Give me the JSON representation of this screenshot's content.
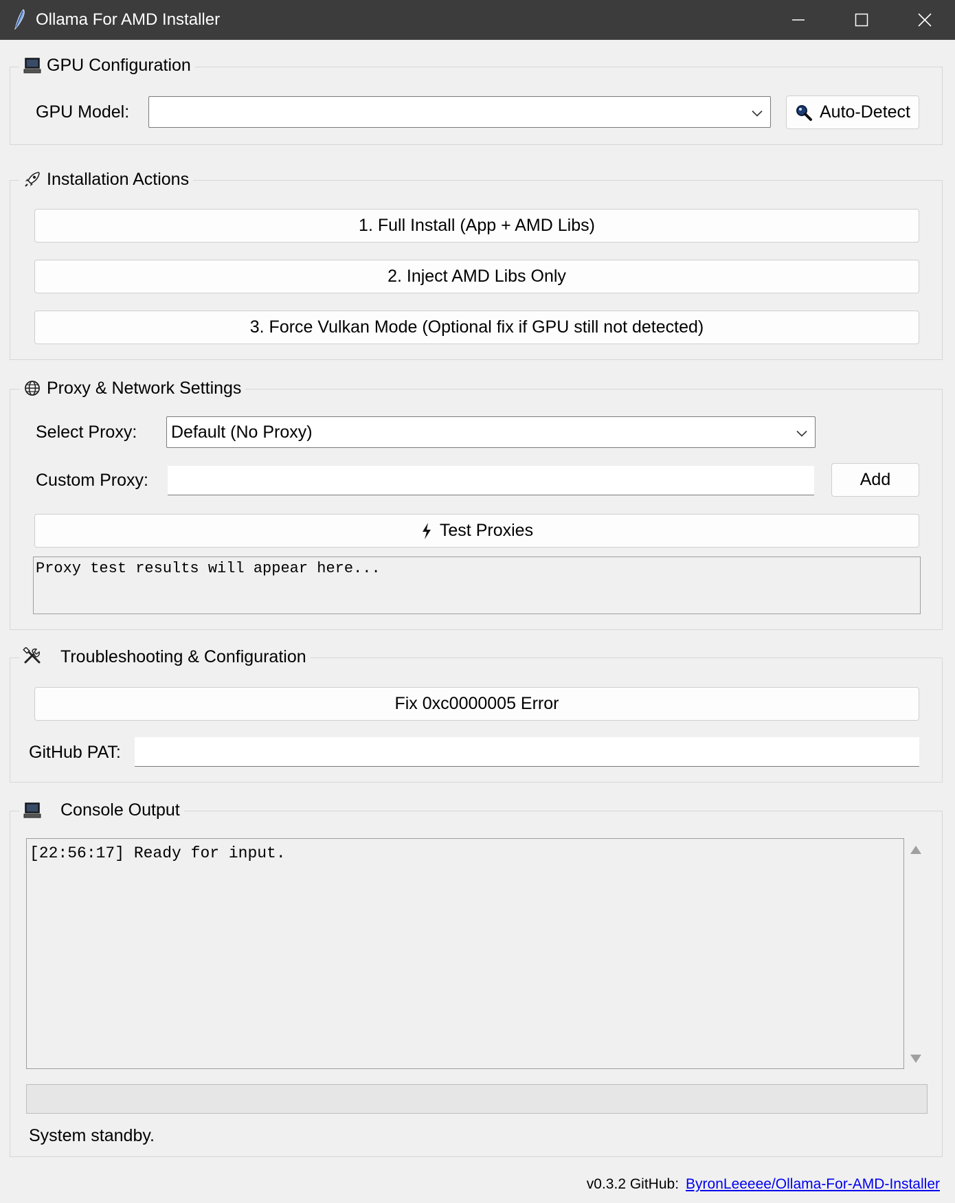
{
  "window": {
    "title": "Ollama For AMD Installer",
    "controls": {
      "minimize": "minimize-icon",
      "maximize": "maximize-icon",
      "close": "close-icon"
    },
    "title_bar_color": "#3c3c3c"
  },
  "gpu_config": {
    "legend": "GPU Configuration",
    "legend_icon": "computer-icon",
    "model_label": "GPU Model:",
    "model_value": "",
    "auto_detect_label": "Auto-Detect",
    "auto_detect_icon": "magnifier-icon"
  },
  "install_actions": {
    "legend": "Installation Actions",
    "legend_icon": "rocket-icon",
    "buttons": [
      {
        "label": "1. Full Install (App + AMD Libs)"
      },
      {
        "label": "2. Inject AMD Libs Only"
      },
      {
        "label": "3. Force Vulkan Mode (Optional fix if GPU still not detected)"
      }
    ]
  },
  "proxy": {
    "legend": "Proxy & Network Settings",
    "legend_icon": "globe-icon",
    "select_label": "Select Proxy:",
    "select_value": "Default (No Proxy)",
    "custom_label": "Custom Proxy:",
    "custom_value": "",
    "add_label": "Add",
    "test_label": "Test Proxies",
    "test_icon": "lightning-icon",
    "results_text": "Proxy test results will appear here..."
  },
  "troubleshooting": {
    "legend": "Troubleshooting & Configuration",
    "legend_icon": "tools-icon",
    "fix_label": "Fix 0xc0000005 Error",
    "pat_label": "GitHub PAT:",
    "pat_value": ""
  },
  "console": {
    "legend": "Console Output",
    "legend_icon": "computer-icon",
    "lines": "[22:56:17] Ready for input.",
    "progress_fraction": 0,
    "status_text": "System standby."
  },
  "footer": {
    "version_text": "v0.3.2 GitHub:",
    "link_text": "ByronLeeeee/Ollama-For-AMD-Installer",
    "link_color": "#0000ee"
  }
}
